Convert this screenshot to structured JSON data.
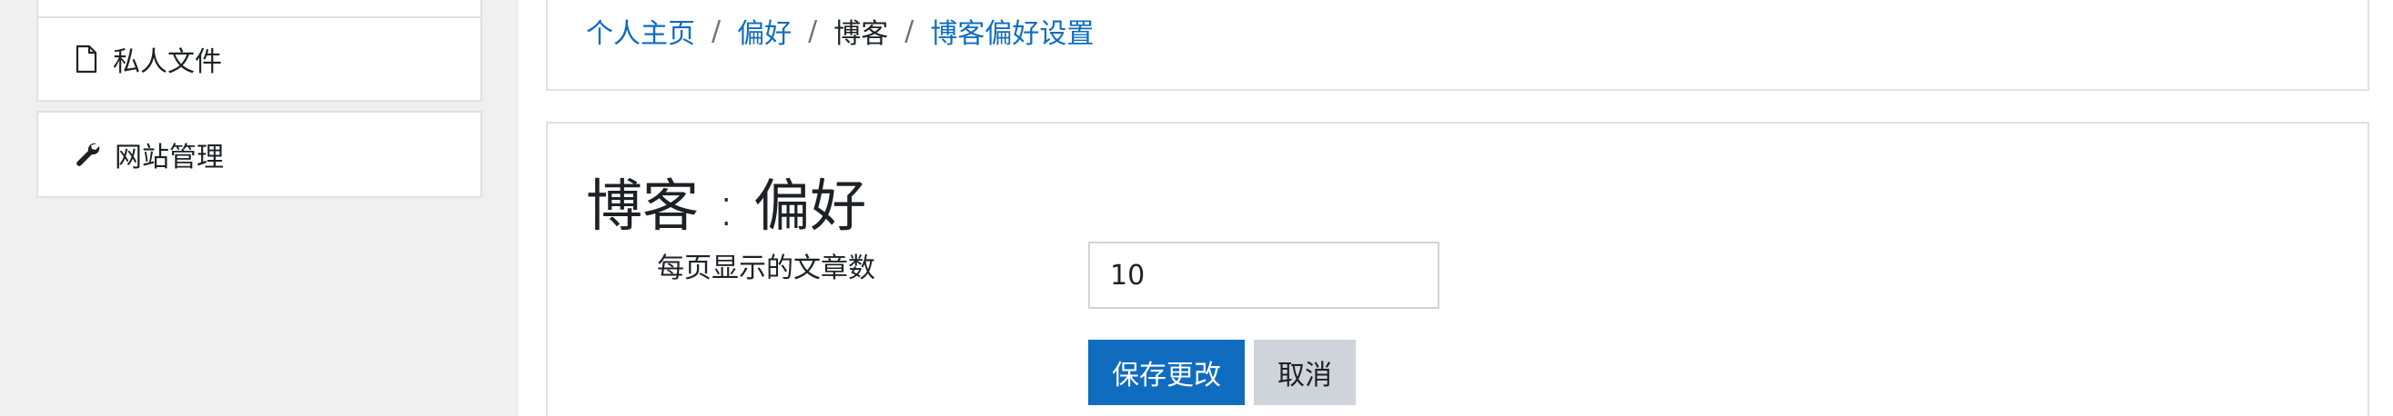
{
  "sidebar": {
    "items": [
      {
        "label": "私人文件",
        "icon": "file-icon"
      },
      {
        "label": "网站管理",
        "icon": "wrench-icon"
      }
    ]
  },
  "breadcrumb": {
    "items": [
      {
        "label": "个人主页",
        "link": true
      },
      {
        "label": "偏好",
        "link": true
      },
      {
        "label": "博客",
        "link": false
      },
      {
        "label": "博客偏好设置",
        "link": true
      }
    ],
    "separator": "/"
  },
  "main": {
    "title": "博客 : 偏好",
    "form": {
      "posts_per_page_label": "每页显示的文章数",
      "posts_per_page_value": "10",
      "save_label": "保存更改",
      "cancel_label": "取消"
    }
  },
  "colors": {
    "link": "#0f6cbf",
    "primary_button": "#0f6cbf",
    "secondary_button": "#ced4da",
    "sidebar_background": "#f0f0f0"
  }
}
